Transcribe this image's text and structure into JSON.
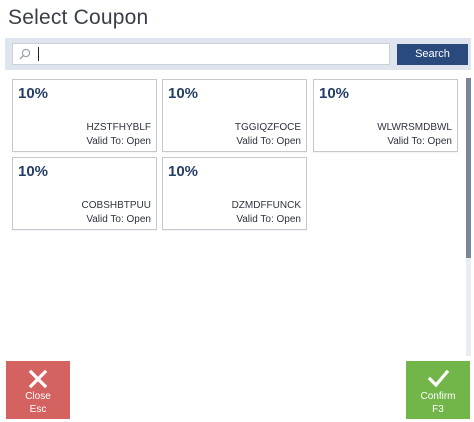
{
  "window": {
    "title": "Select Coupon"
  },
  "search": {
    "value": "",
    "button_label": "Search",
    "icon": "search-icon"
  },
  "coupons": [
    {
      "discount": "10%",
      "code": "HZSTFHYBLF",
      "valid": "Valid To: Open"
    },
    {
      "discount": "10%",
      "code": "TGGIQZFOCE",
      "valid": "Valid To: Open"
    },
    {
      "discount": "10%",
      "code": "WLWRSMDBWL",
      "valid": "Valid To: Open"
    },
    {
      "discount": "10%",
      "code": "COBSHBTPUU",
      "valid": "Valid To: Open"
    },
    {
      "discount": "10%",
      "code": "DZMDFFUNCK",
      "valid": "Valid To: Open"
    }
  ],
  "actions": {
    "close": {
      "label": "Close",
      "shortcut": "Esc",
      "icon": "close-icon",
      "color": "#d46260"
    },
    "confirm": {
      "label": "Confirm",
      "shortcut": "F3",
      "icon": "checkmark-icon",
      "color": "#72b649"
    }
  },
  "colors": {
    "accent": "#2a4a7d",
    "discount_text": "#253e68"
  }
}
